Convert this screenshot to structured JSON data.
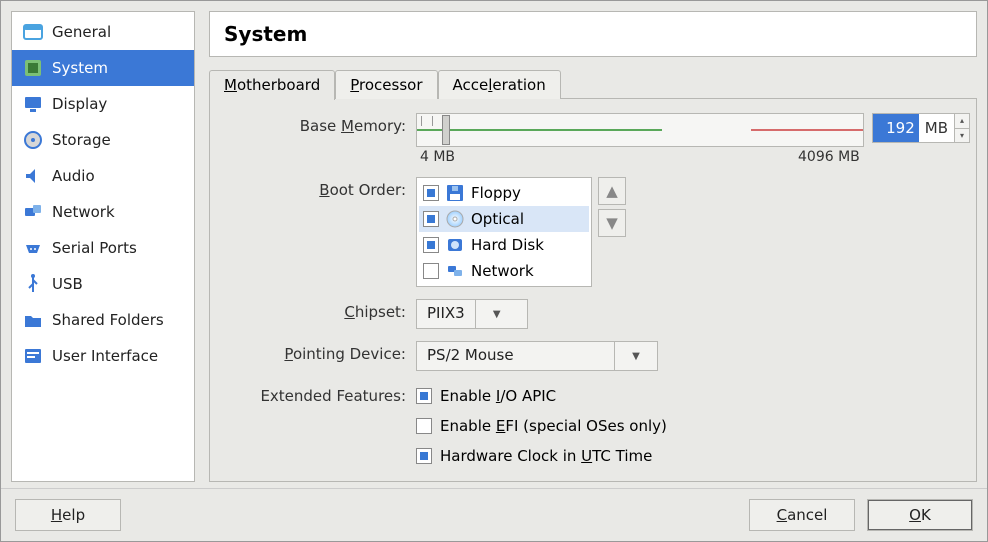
{
  "sidebar": {
    "items": [
      {
        "label": "General",
        "icon": "general"
      },
      {
        "label": "System",
        "icon": "system",
        "active": true
      },
      {
        "label": "Display",
        "icon": "display"
      },
      {
        "label": "Storage",
        "icon": "storage"
      },
      {
        "label": "Audio",
        "icon": "audio"
      },
      {
        "label": "Network",
        "icon": "network"
      },
      {
        "label": "Serial Ports",
        "icon": "serial"
      },
      {
        "label": "USB",
        "icon": "usb"
      },
      {
        "label": "Shared Folders",
        "icon": "folder"
      },
      {
        "label": "User Interface",
        "icon": "ui"
      }
    ]
  },
  "title": "System",
  "tabs": [
    "Motherboard",
    "Processor",
    "Acceleration"
  ],
  "active_tab": 0,
  "labels": {
    "base_memory": "Base Memory:",
    "boot_order": "Boot Order:",
    "chipset": "Chipset:",
    "pointing": "Pointing Device:",
    "extended": "Extended Features:",
    "help": "Help",
    "cancel": "Cancel",
    "ok": "OK"
  },
  "base_memory": {
    "value": "192",
    "unit": "MB",
    "min_label": "4 MB",
    "max_label": "4096 MB"
  },
  "boot_order": [
    {
      "label": "Floppy",
      "checked": true,
      "icon": "floppy"
    },
    {
      "label": "Optical",
      "checked": true,
      "icon": "optical",
      "selected": true
    },
    {
      "label": "Hard Disk",
      "checked": true,
      "icon": "hdd"
    },
    {
      "label": "Network",
      "checked": false,
      "icon": "net"
    }
  ],
  "chipset": "PIIX3",
  "pointing": "PS/2 Mouse",
  "features": [
    {
      "label": "Enable I/O APIC",
      "checked": true,
      "mn": 8
    },
    {
      "label": "Enable EFI (special OSes only)",
      "checked": false,
      "mn": 7
    },
    {
      "label": "Hardware Clock in UTC Time",
      "checked": true,
      "mn": 18
    }
  ]
}
